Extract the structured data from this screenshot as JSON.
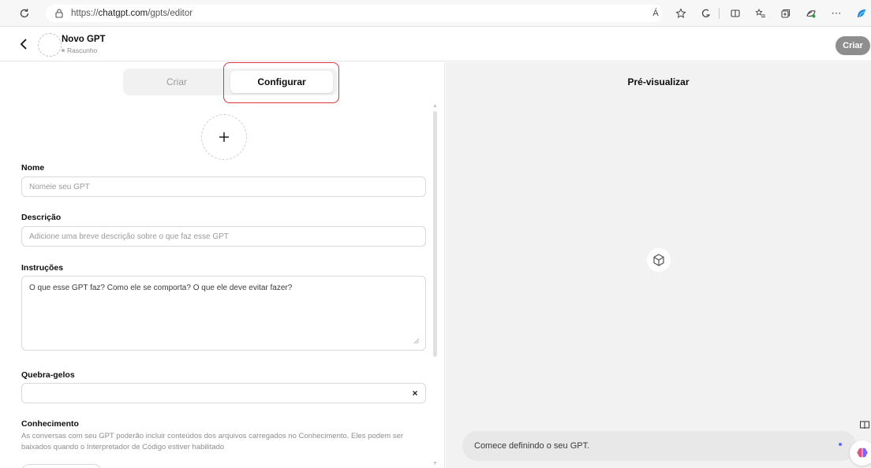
{
  "browser": {
    "url_prefix": "https://",
    "url_host": "chatgpt.com",
    "url_path": "/gpts/editor",
    "read_aloud_label": "Á",
    "more_label": "⋯"
  },
  "header": {
    "gpt_name": "Novo GPT",
    "status": "Rascunho",
    "create_button": "Criar"
  },
  "tabs": {
    "criar": "Criar",
    "configurar": "Configurar"
  },
  "form": {
    "name_label": "Nome",
    "name_placeholder": "Nomeie seu GPT",
    "description_label": "Descrição",
    "description_placeholder": "Adicione uma breve descrição sobre o que faz esse GPT",
    "instructions_label": "Instruções",
    "instructions_placeholder": "O que esse GPT faz? Como ele se comporta? O que ele deve evitar fazer?",
    "icebreakers_label": "Quebra-gelos",
    "icebreaker_clear": "×",
    "knowledge_label": "Conhecimento",
    "knowledge_help": "As conversas com seu GPT poderão incluir conteúdos dos arquivos carregados no Conhecimento. Eles podem ser baixados quando o Interpretador de Código estiver habilitado"
  },
  "preview": {
    "title": "Pré-visualizar",
    "prompt_placeholder": "Comece definindo o seu GPT."
  },
  "colors": {
    "highlight": "#e0353b",
    "create_button_bg": "#8e8e8e",
    "preview_bg": "#f2f2f2"
  }
}
